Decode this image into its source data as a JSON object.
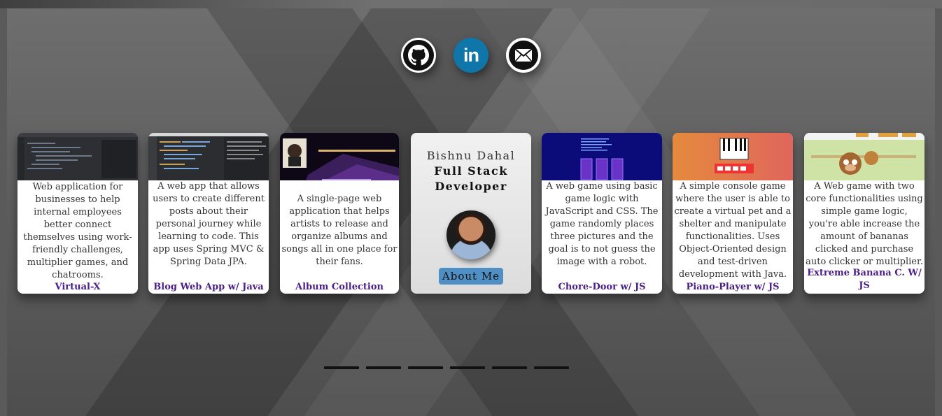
{
  "social": {
    "github_label": "GitHub",
    "linkedin_label": "in",
    "email_label": "Email"
  },
  "profile": {
    "name": "Bishnu Dahal",
    "role_line1": "Full Stack",
    "role_line2": "Developer",
    "about_button": "About Me"
  },
  "projects": [
    {
      "title": "Virtual-X",
      "description": "Web application for businesses to help internal employees better connect themselves using work-friendly challenges, multiplier games, and chatrooms."
    },
    {
      "title": "Blog Web App w/ Java",
      "description": "A web app that allows users to create different posts about their personal journey while learning to code. This app uses Spring MVC & Spring Data JPA."
    },
    {
      "title": "Album Collection",
      "description": "A single-page web application that helps artists to release and organize albums and songs all in one place for their fans."
    },
    {
      "title": "Chore-Door w/ JS",
      "description": "A web game using basic game logic with JavaScript and CSS. The game randomly places three pictures and the goal is to not guess the image with a robot."
    },
    {
      "title": "Piano-Player w/ JS",
      "description": "A simple console game where the user is able to create a virtual pet and a shelter and manipulate functionalities. Uses Object-Oriented design and test-driven development with Java."
    },
    {
      "title": "Extreme Banana C. W/ JS",
      "description": "A Web game with two core functionalities using simple game logic, you're able increase the amount of bananas clicked and purchase auto clicker or multiplier."
    }
  ],
  "carousel": {
    "indicator_count": 6
  },
  "colors": {
    "title": "#4b1f85",
    "linkedin": "#0e76a8",
    "about_button": "#4f8fc3"
  }
}
